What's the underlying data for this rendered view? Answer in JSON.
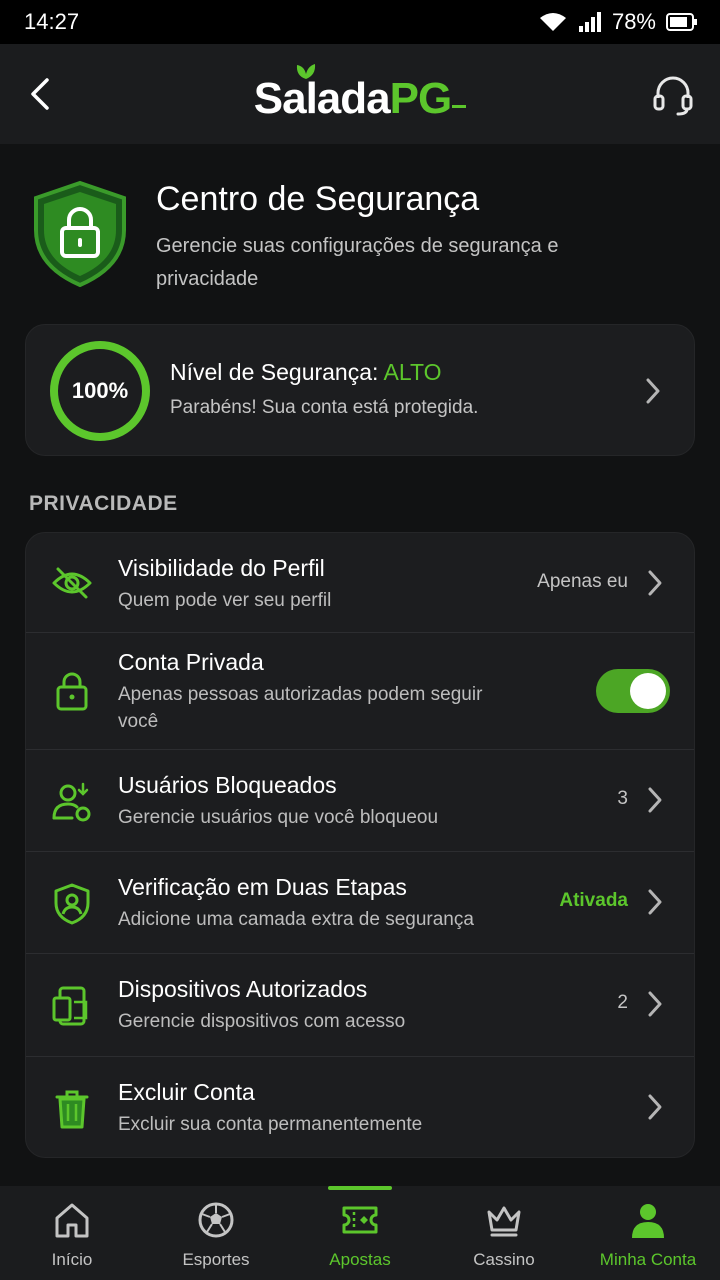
{
  "status_bar": {
    "time": "14:27",
    "battery": "78%"
  },
  "app_bar": {
    "logo_white": "Salada",
    "logo_green": "PG"
  },
  "hero": {
    "title": "Centro de Segurança",
    "subtitle": "Gerencie suas configurações de segurança e privacidade"
  },
  "security_level": {
    "percent_label": "100%",
    "percent_value": 100,
    "title_prefix": "Nível de Segurança: ",
    "title_value": "ALTO",
    "subtitle": "Parabéns! Sua conta está protegida."
  },
  "privacy": {
    "section_title": "PRIVACIDADE",
    "items": [
      {
        "icon": "eye-off-icon",
        "title": "Visibilidade do Perfil",
        "subtitle": "Quem pode ver seu perfil",
        "value": "Apenas eu"
      },
      {
        "icon": "lock-icon",
        "title": "Conta Privada",
        "subtitle": "Apenas pessoas autorizadas podem seguir você",
        "toggle_on": true
      },
      {
        "icon": "user-block-icon",
        "title": "Usuários Bloqueados",
        "subtitle": "Gerencie usuários que você bloqueou",
        "value": "3"
      },
      {
        "icon": "shield-user-icon",
        "title": "Verificação em Duas Etapas",
        "subtitle": "Adicione uma camada extra de segurança",
        "value": "Ativada"
      },
      {
        "icon": "devices-icon",
        "title": "Dispositivos Autorizados",
        "subtitle": "Gerencie dispositivos com acesso",
        "value": "2"
      },
      {
        "icon": "trash-icon",
        "title": "Excluir Conta",
        "subtitle": "Excluir sua conta permanentemente"
      }
    ]
  },
  "bottom_nav": [
    {
      "icon": "home-icon",
      "label": "Início"
    },
    {
      "icon": "soccer-ball-icon",
      "label": "Esportes"
    },
    {
      "icon": "ticket-icon",
      "label": "Apostas"
    },
    {
      "icon": "crown-icon",
      "label": "Cassino"
    },
    {
      "icon": "user-icon",
      "label": "Minha Conta"
    }
  ],
  "colors": {
    "accent": "#5cc62c",
    "background": "#111213",
    "card": "#1c1d1f"
  }
}
